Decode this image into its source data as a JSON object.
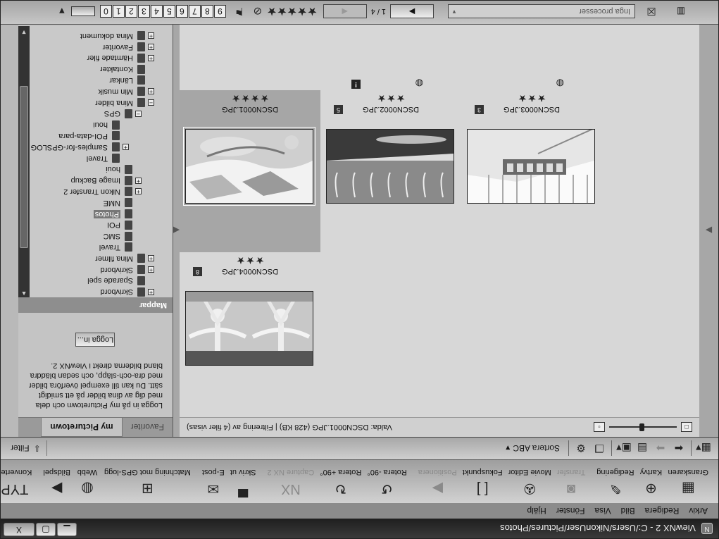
{
  "window": {
    "title": "ViewNX 2 - C:/Users/NikonUser/Pictures/Photos",
    "app_icon": "N",
    "minimize": "▁",
    "maximize": "▢",
    "close": "X"
  },
  "menu": [
    "Arkiv",
    "Redigera",
    "Bild",
    "Visa",
    "Fönster",
    "Hjälp"
  ],
  "toolbar": [
    {
      "label": "Granskaren",
      "icon": "grid-icon",
      "glyph": "▦",
      "enabled": true
    },
    {
      "label": "Kartvy",
      "icon": "globe-icon",
      "glyph": "⊕",
      "enabled": true
    },
    {
      "label": "Redigering",
      "icon": "pen-icon",
      "glyph": "✎",
      "enabled": true
    },
    {
      "label": "Transfer",
      "icon": "camera-icon",
      "glyph": "◙",
      "enabled": false
    },
    {
      "label": "Movie Editor",
      "icon": "film-reel-icon",
      "glyph": "✇",
      "enabled": true
    },
    {
      "label": "Fokuspunkt",
      "icon": "focus-brackets-icon",
      "glyph": "[ ]",
      "enabled": true
    },
    {
      "label": "Positionera",
      "icon": "play-icon",
      "glyph": "▶",
      "enabled": false
    },
    {
      "label": "Rotera -90°",
      "icon": "rotate-left-icon",
      "glyph": "↺",
      "enabled": true
    },
    {
      "label": "Rotera +90°",
      "icon": "rotate-right-icon",
      "glyph": "↻",
      "enabled": true
    },
    {
      "label": "Capture NX 2",
      "icon": "nx-icon",
      "glyph": "NX",
      "enabled": false
    },
    {
      "label": "Skriv ut",
      "icon": "printer-icon",
      "glyph": "▀",
      "enabled": true
    },
    {
      "label": "E-post",
      "icon": "envelope-icon",
      "glyph": "✉",
      "enabled": true
    },
    {
      "label": "Matchning mot GPS-logg",
      "icon": "gps-match-icon",
      "glyph": "⊞",
      "enabled": true
    },
    {
      "label": "Webb",
      "icon": "web-globe-icon",
      "glyph": "◍",
      "enabled": true
    },
    {
      "label": "Bildspel",
      "icon": "slideshow-icon",
      "glyph": "▶",
      "enabled": true
    },
    {
      "label": "Konvertering",
      "icon": "convert-file-icon",
      "glyph": "TYPE",
      "enabled": true
    }
  ],
  "navbar": {
    "sort_label": "Sortera ABC",
    "filter_label": "Filter"
  },
  "left_panel": {
    "tabs": [
      "my Picturetown",
      "Favoriter"
    ],
    "picturetown_text": "Logga in på my Picturetown och dela med dig av dina bilder på ett smidigt sätt. Du kan till exempel överföra bilder med dra-och-släpp, och sedan bläddra bland bilderna direkt i ViewNX 2.",
    "login_label": "Logga in...",
    "folders_title": "Mappar",
    "tree": [
      {
        "label": "Skrivbord",
        "depth": 1,
        "exp": "+",
        "y": 0
      },
      {
        "label": "Sparade spel",
        "depth": 1,
        "exp": "",
        "y": 1
      },
      {
        "label": "Skrivbord",
        "depth": 1,
        "exp": "+"
      },
      {
        "label": "Mina filmer",
        "depth": 1,
        "exp": "+"
      },
      {
        "label": "Travel",
        "depth": 2,
        "exp": ""
      },
      {
        "label": "SMC",
        "depth": 2,
        "exp": ""
      },
      {
        "label": "POI",
        "depth": 2,
        "exp": ""
      },
      {
        "label": "Photos",
        "depth": 2,
        "exp": "",
        "selected": true
      },
      {
        "label": "NME",
        "depth": 2,
        "exp": ""
      },
      {
        "label": "Nikon Transfer 2",
        "depth": 2,
        "exp": "+"
      },
      {
        "label": "Image Backup",
        "depth": 2,
        "exp": "+"
      },
      {
        "label": "houi",
        "depth": 2,
        "exp": ""
      },
      {
        "label": "Travel",
        "depth": 3,
        "exp": ""
      },
      {
        "label": "Samples-for-GPSLOG",
        "depth": 3,
        "exp": "+"
      },
      {
        "label": "POI-data-para",
        "depth": 3,
        "exp": ""
      },
      {
        "label": "houi",
        "depth": 3,
        "exp": ""
      },
      {
        "label": "GPS",
        "depth": 2,
        "exp": "−"
      },
      {
        "label": "Mina bilder",
        "depth": 1,
        "exp": "−"
      },
      {
        "label": "Min musik",
        "depth": 1,
        "exp": "+"
      },
      {
        "label": "Länkar",
        "depth": 1,
        "exp": ""
      },
      {
        "label": "Kontakter",
        "depth": 1,
        "exp": ""
      },
      {
        "label": "Hämtade filer",
        "depth": 1,
        "exp": "+"
      },
      {
        "label": "Favoriter",
        "depth": 1,
        "exp": "+"
      },
      {
        "label": "Mina dokument",
        "depth": 1,
        "exp": "+"
      }
    ]
  },
  "content": {
    "selection_info": "Valda: DSCN0001.JPG (428 KB) | Filtrering av (4 filer visas)",
    "zoom_level": 0.48,
    "thumbnails": [
      {
        "name": "DSCN0001.JPG",
        "stars": "★★★★",
        "selected": true,
        "number": "",
        "globe": false,
        "warn": false
      },
      {
        "name": "DSCN0002.JPG",
        "stars": "★★★",
        "selected": false,
        "number": "5",
        "globe": true,
        "warn": true
      },
      {
        "name": "DSCN0003.JPG",
        "stars": "★★★",
        "selected": false,
        "number": "3",
        "globe": true,
        "warn": false
      },
      {
        "name": "DSCN0004.JPG",
        "stars": "★★★",
        "selected": false,
        "number": "8",
        "globe": false,
        "warn": false
      }
    ]
  },
  "topbar": {
    "labels": [
      "0",
      "1",
      "2",
      "3",
      "4",
      "5",
      "6",
      "7",
      "8",
      "9"
    ],
    "stars": "★★★★★",
    "page_text": "1 / 4",
    "prev": "◀",
    "next": "▶",
    "search_placeholder": "Inga processer"
  }
}
